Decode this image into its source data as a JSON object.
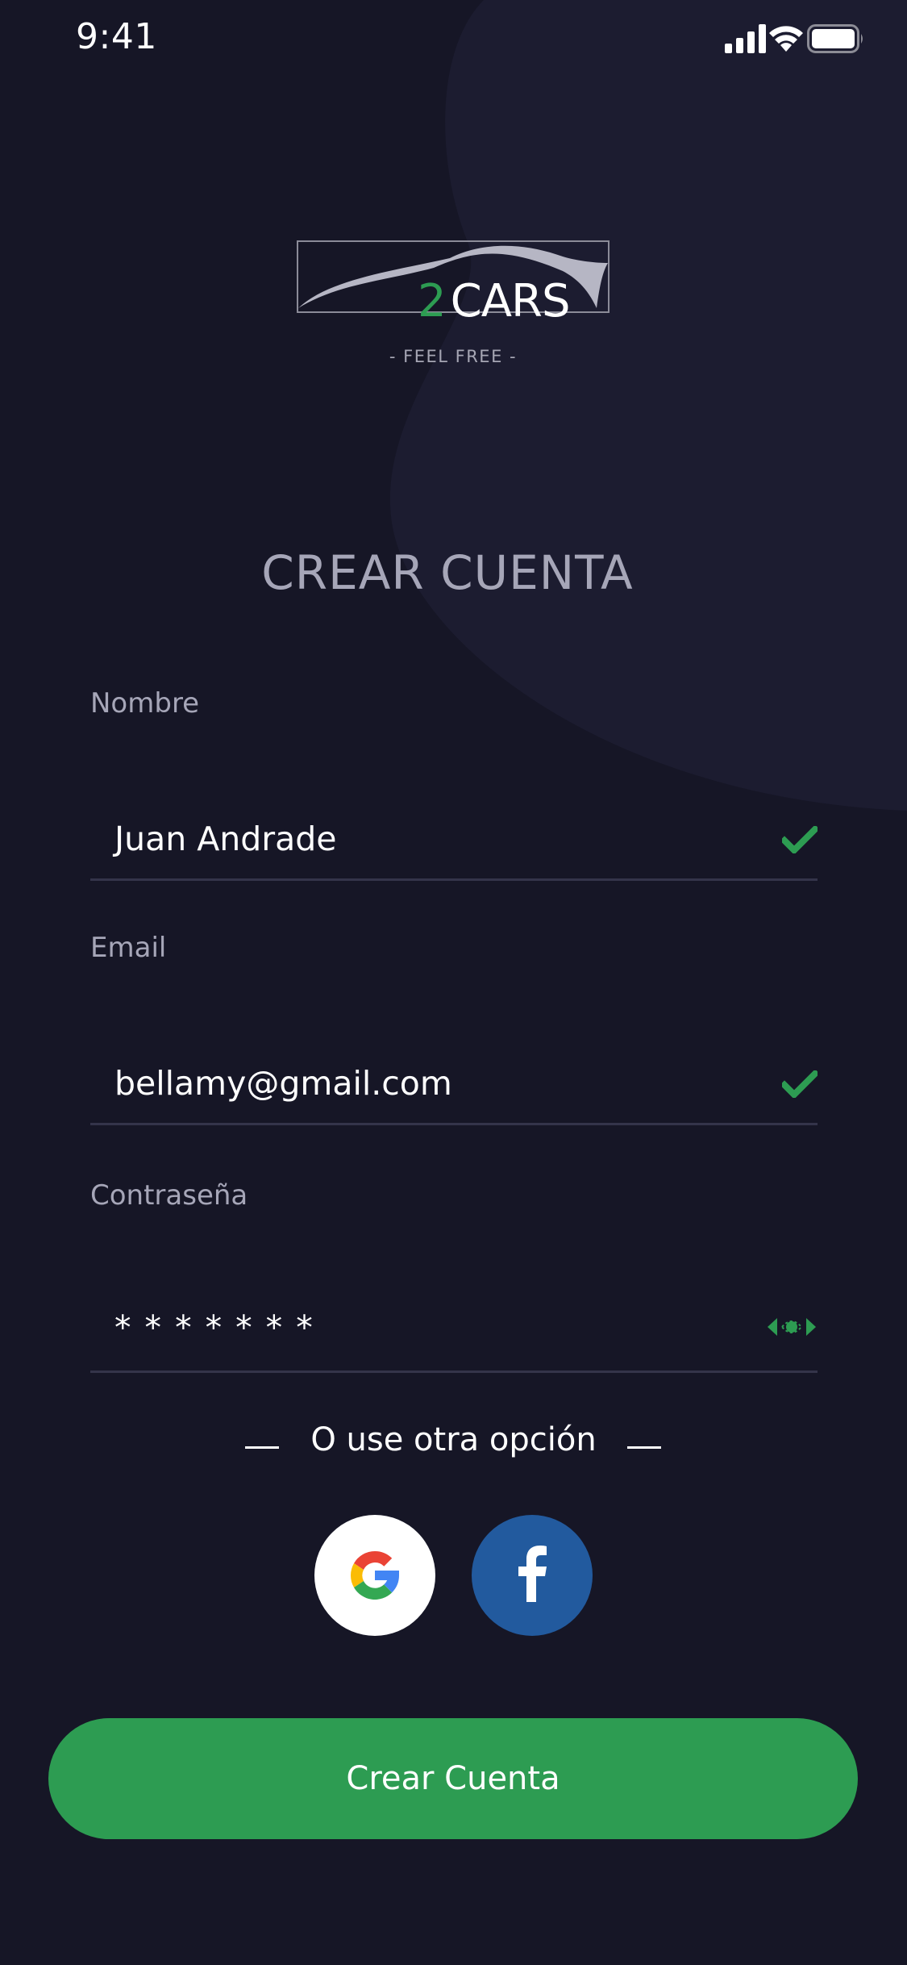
{
  "status_bar": {
    "time": "9:41",
    "icons": [
      "signal-icon",
      "wifi-icon",
      "battery-icon"
    ]
  },
  "brand": {
    "number": "2",
    "name": "CARS",
    "tagline": "- FEEL FREE -"
  },
  "title": "CREAR CUENTA",
  "form": {
    "name": {
      "label": "Nombre",
      "value": "Juan Andrade",
      "icon": "check-icon"
    },
    "email": {
      "label": "Email",
      "value": "bellamy@gmail.com",
      "icon": "check-icon"
    },
    "password": {
      "label": "Contraseña",
      "value": "* * * * * * *",
      "icon": "eye-icon"
    }
  },
  "divider_text": "O use otra opción",
  "social": {
    "google_icon": "google-icon",
    "facebook_icon": "facebook-icon"
  },
  "submit_label": "Crear Cuenta",
  "colors": {
    "background": "#161626",
    "accent": "#2d9c52",
    "facebook": "#225a9e",
    "label": "#a6a6b8"
  }
}
